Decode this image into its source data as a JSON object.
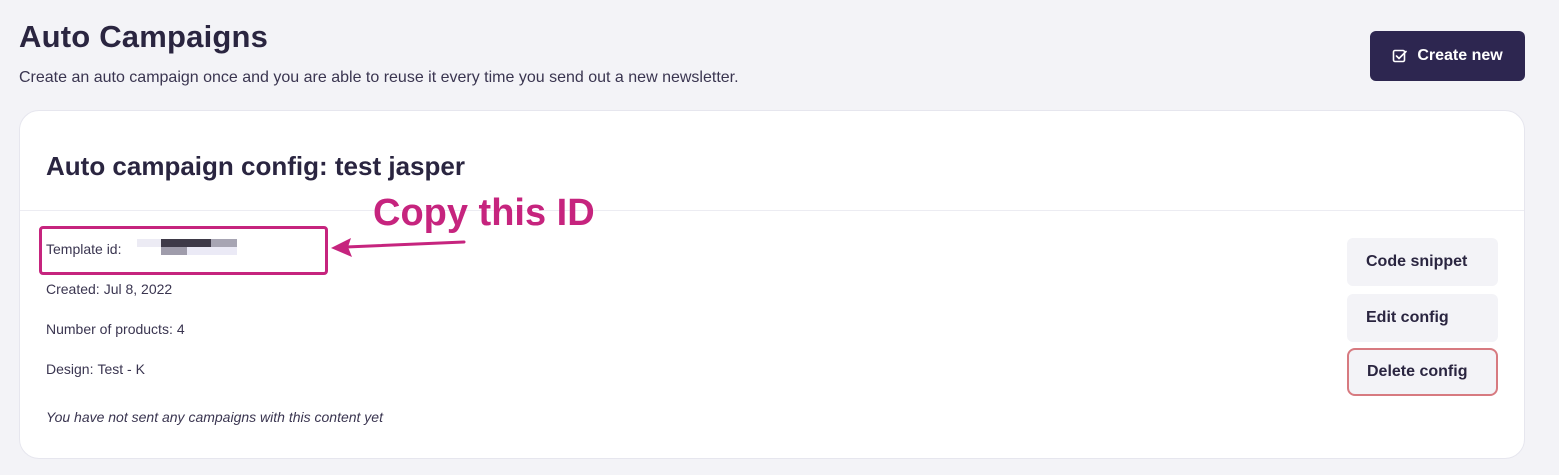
{
  "header": {
    "title": "Auto Campaigns",
    "subtitle": "Create an auto campaign once and you are able to reuse it every time you send out a new newsletter.",
    "create_button_label": "Create new"
  },
  "config_card": {
    "title": "Auto campaign config: test jasper",
    "template_id_label": "Template id:",
    "created_label": "Created:",
    "created_value": "Jul 8, 2022",
    "products_label": "Number of products:",
    "products_value": "4",
    "design_label": "Design:",
    "design_value": "Test - K",
    "status_note": "You have not sent any campaigns with this content yet"
  },
  "actions": {
    "code_snippet_label": "Code snippet",
    "edit_label": "Edit config",
    "delete_label": "Delete config"
  },
  "annotation": {
    "text": "Copy this ID",
    "color": "#c6247e"
  },
  "icons": {
    "create_button_icon": "checkbox-edit-icon"
  },
  "colors": {
    "primary": "#2d2650",
    "background": "#f3f3f7",
    "danger_border": "#d77a80"
  }
}
